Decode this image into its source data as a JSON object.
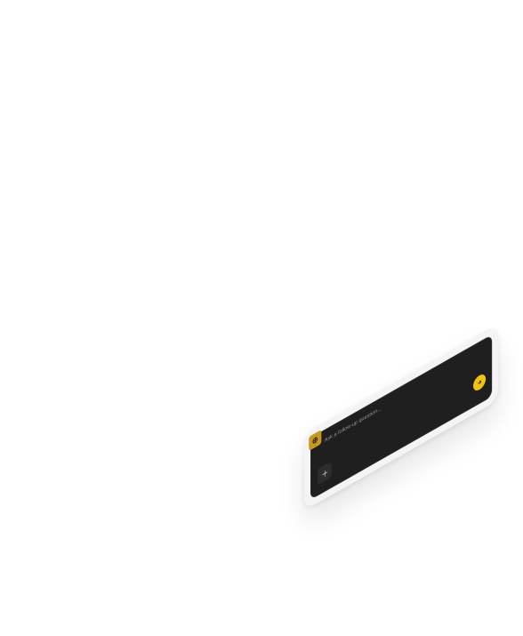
{
  "composer": {
    "placeholder": "Ask a follow-up question...",
    "icons": {
      "badge": "sparkle-icon",
      "add": "plus-icon",
      "send": "arrow-icon"
    },
    "colors": {
      "panel": "#1f1f1f",
      "frame": "#f4f4f4",
      "badge": "#c79a1f",
      "send": "#f2c312",
      "placeholder": "#9a9a9a"
    }
  }
}
